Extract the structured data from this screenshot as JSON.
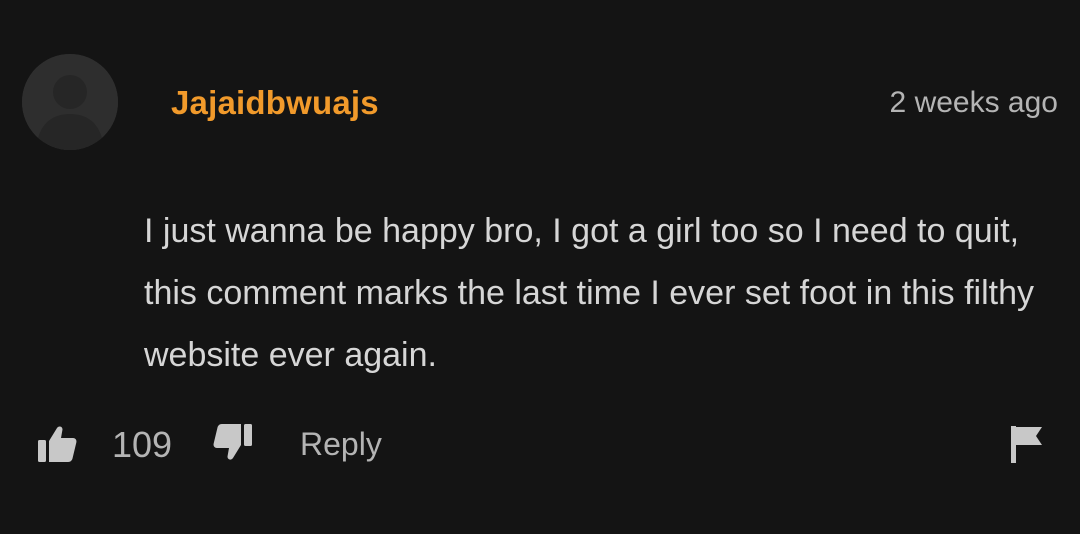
{
  "comment": {
    "username": "Jajaidbwuajs",
    "timestamp": "2 weeks ago",
    "text": "I just wanna be happy bro, I got a girl too so I need to quit, this comment marks the last time I ever set foot in this filthy website ever again.",
    "like_count": "109",
    "reply_label": "Reply"
  },
  "icons": {
    "avatar": "user-silhouette",
    "like": "thumbs-up-icon",
    "dislike": "thumbs-down-icon",
    "report": "flag-icon"
  },
  "colors": {
    "background": "#141414",
    "username": "#f19a2b",
    "body_text": "#d6d6d6",
    "muted_text": "#b4b4b4",
    "icon": "#c8c8c8"
  }
}
